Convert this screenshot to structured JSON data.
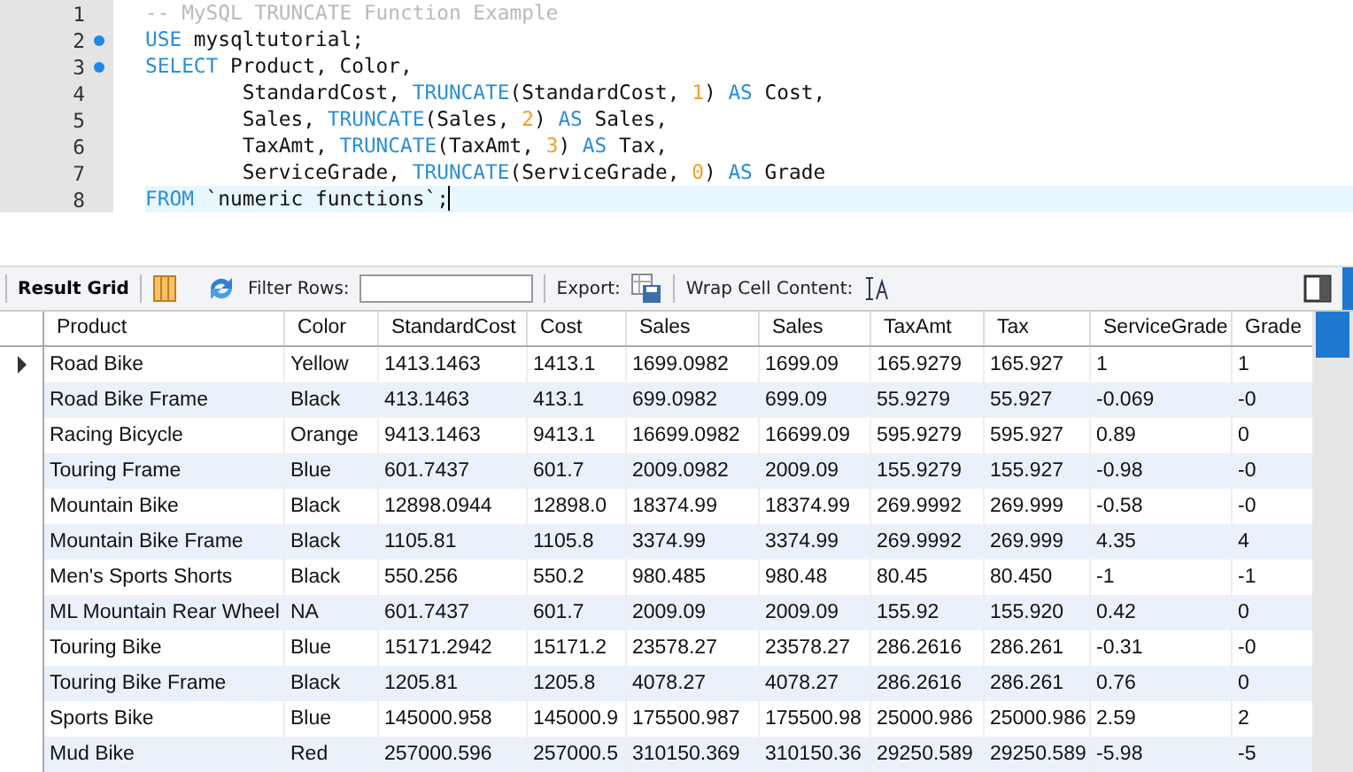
{
  "editor": {
    "lines": [
      {
        "number": "1",
        "marker": false,
        "current": false,
        "tokens": [
          {
            "kind": "comment",
            "text": "-- MySQL TRUNCATE Function Example"
          }
        ]
      },
      {
        "number": "2",
        "marker": true,
        "current": false,
        "tokens": [
          {
            "kind": "keyword",
            "text": "USE"
          },
          {
            "kind": "plain",
            "text": " mysqltutorial;"
          }
        ]
      },
      {
        "number": "3",
        "marker": true,
        "current": false,
        "tokens": [
          {
            "kind": "keyword",
            "text": "SELECT"
          },
          {
            "kind": "plain",
            "text": " Product, Color,"
          }
        ]
      },
      {
        "number": "4",
        "marker": false,
        "current": false,
        "tokens": [
          {
            "kind": "plain",
            "text": "        StandardCost, "
          },
          {
            "kind": "keyword",
            "text": "TRUNCATE"
          },
          {
            "kind": "plain",
            "text": "(StandardCost, "
          },
          {
            "kind": "number",
            "text": "1"
          },
          {
            "kind": "plain",
            "text": ") "
          },
          {
            "kind": "keyword",
            "text": "AS"
          },
          {
            "kind": "plain",
            "text": " Cost,"
          }
        ]
      },
      {
        "number": "5",
        "marker": false,
        "current": false,
        "tokens": [
          {
            "kind": "plain",
            "text": "        Sales, "
          },
          {
            "kind": "keyword",
            "text": "TRUNCATE"
          },
          {
            "kind": "plain",
            "text": "(Sales, "
          },
          {
            "kind": "number",
            "text": "2"
          },
          {
            "kind": "plain",
            "text": ") "
          },
          {
            "kind": "keyword",
            "text": "AS"
          },
          {
            "kind": "plain",
            "text": " Sales,"
          }
        ]
      },
      {
        "number": "6",
        "marker": false,
        "current": false,
        "tokens": [
          {
            "kind": "plain",
            "text": "        TaxAmt, "
          },
          {
            "kind": "keyword",
            "text": "TRUNCATE"
          },
          {
            "kind": "plain",
            "text": "(TaxAmt, "
          },
          {
            "kind": "number",
            "text": "3"
          },
          {
            "kind": "plain",
            "text": ") "
          },
          {
            "kind": "keyword",
            "text": "AS"
          },
          {
            "kind": "plain",
            "text": " Tax,"
          }
        ]
      },
      {
        "number": "7",
        "marker": false,
        "current": false,
        "tokens": [
          {
            "kind": "plain",
            "text": "        ServiceGrade, "
          },
          {
            "kind": "keyword",
            "text": "TRUNCATE"
          },
          {
            "kind": "plain",
            "text": "(ServiceGrade, "
          },
          {
            "kind": "number",
            "text": "0"
          },
          {
            "kind": "plain",
            "text": ") "
          },
          {
            "kind": "keyword",
            "text": "AS"
          },
          {
            "kind": "plain",
            "text": " Grade"
          }
        ]
      },
      {
        "number": "8",
        "marker": false,
        "current": true,
        "tokens": [
          {
            "kind": "keyword",
            "text": "FROM"
          },
          {
            "kind": "plain",
            "text": " `numeric functions`;"
          }
        ]
      }
    ]
  },
  "toolbar": {
    "result_grid": "Result Grid",
    "filter_label": "Filter Rows:",
    "export_label": "Export:",
    "wrap_label": "Wrap Cell Content:"
  },
  "table": {
    "columns": [
      "Product",
      "Color",
      "StandardCost",
      "Cost",
      "Sales",
      "Sales",
      "TaxAmt",
      "Tax",
      "ServiceGrade",
      "Grade"
    ],
    "rows": [
      {
        "selected": true,
        "cells": [
          "Road Bike",
          "Yellow",
          "1413.1463",
          "1413.1",
          "1699.0982",
          "1699.09",
          "165.9279",
          "165.927",
          "1",
          "1"
        ]
      },
      {
        "selected": false,
        "cells": [
          "Road Bike Frame",
          "Black",
          "413.1463",
          "413.1",
          "699.0982",
          "699.09",
          "55.9279",
          "55.927",
          "-0.069",
          "-0"
        ]
      },
      {
        "selected": false,
        "cells": [
          "Racing Bicycle",
          "Orange",
          "9413.1463",
          "9413.1",
          "16699.0982",
          "16699.09",
          "595.9279",
          "595.927",
          "0.89",
          "0"
        ]
      },
      {
        "selected": false,
        "cells": [
          "Touring Frame",
          "Blue",
          "601.7437",
          "601.7",
          "2009.0982",
          "2009.09",
          "155.9279",
          "155.927",
          "-0.98",
          "-0"
        ]
      },
      {
        "selected": false,
        "cells": [
          "Mountain Bike",
          "Black",
          "12898.0944",
          "12898.0",
          "18374.99",
          "18374.99",
          "269.9992",
          "269.999",
          "-0.58",
          "-0"
        ]
      },
      {
        "selected": false,
        "cells": [
          "Mountain Bike Frame",
          "Black",
          "1105.81",
          "1105.8",
          "3374.99",
          "3374.99",
          "269.9992",
          "269.999",
          "4.35",
          "4"
        ]
      },
      {
        "selected": false,
        "cells": [
          "Men's Sports Shorts",
          "Black",
          "550.256",
          "550.2",
          "980.485",
          "980.48",
          "80.45",
          "80.450",
          "-1",
          "-1"
        ]
      },
      {
        "selected": false,
        "cells": [
          "ML Mountain Rear Wheel",
          "NA",
          "601.7437",
          "601.7",
          "2009.09",
          "2009.09",
          "155.92",
          "155.920",
          "0.42",
          "0"
        ]
      },
      {
        "selected": false,
        "cells": [
          "Touring Bike",
          "Blue",
          "15171.2942",
          "15171.2",
          "23578.27",
          "23578.27",
          "286.2616",
          "286.261",
          "-0.31",
          "-0"
        ]
      },
      {
        "selected": false,
        "cells": [
          "Touring Bike Frame",
          "Black",
          "1205.81",
          "1205.8",
          "4078.27",
          "4078.27",
          "286.2616",
          "286.261",
          "0.76",
          "0"
        ]
      },
      {
        "selected": false,
        "cells": [
          "Sports Bike",
          "Blue",
          "145000.958",
          "145000.9",
          "175500.987",
          "175500.98",
          "25000.986",
          "25000.986",
          "2.59",
          "2"
        ]
      },
      {
        "selected": false,
        "cells": [
          "Mud Bike",
          "Red",
          "257000.596",
          "257000.5",
          "310150.369",
          "310150.36",
          "29250.589",
          "29250.589",
          "-5.98",
          "-5"
        ]
      }
    ]
  }
}
